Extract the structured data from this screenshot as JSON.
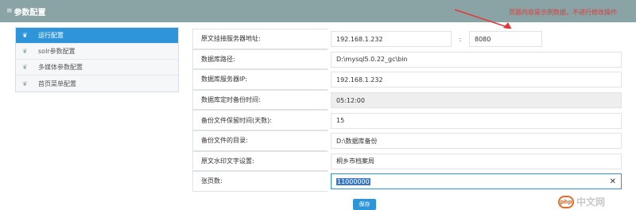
{
  "header": {
    "icon": "menu-lines-icon",
    "title": "参数配置"
  },
  "annotation": {
    "text": "页面内容是示例数据，不进行修改操作",
    "color": "#e03a3a"
  },
  "sidebar": {
    "items": [
      {
        "label": "运行配置",
        "active": true
      },
      {
        "label": "solr参数配置",
        "active": false
      },
      {
        "label": "多媒体参数配置",
        "active": false
      },
      {
        "label": "首页菜单配置",
        "active": false
      }
    ]
  },
  "form": {
    "server_label": "原文挂接服务器地址:",
    "server_ip": "192.168.1.232",
    "colon": ":",
    "server_port": "8080",
    "db_path_label": "数据库路径:",
    "db_path": "D:\\mysql5.0.22_gc\\bin",
    "db_server_label": "数据库服务器IP:",
    "db_server": "192.168.1.232",
    "backup_time_label": "数据库定时备份时间:",
    "backup_time": "05:12:00",
    "retention_label": "备份文件保留时间(天数):",
    "retention": "15",
    "backup_dir_label": "备份文件的目录:",
    "backup_dir": "D:\\数据库备份",
    "watermark_label": "原文水印文字设置:",
    "watermark_text": "桐乡市档案局",
    "pages_label": "张页数:",
    "pages": "11000000"
  },
  "save_label": "保存",
  "site_watermark": {
    "logo": "php",
    "text": "中文网"
  },
  "colors": {
    "accent": "#2e95d8",
    "titlebar": "#8aa3a5"
  }
}
